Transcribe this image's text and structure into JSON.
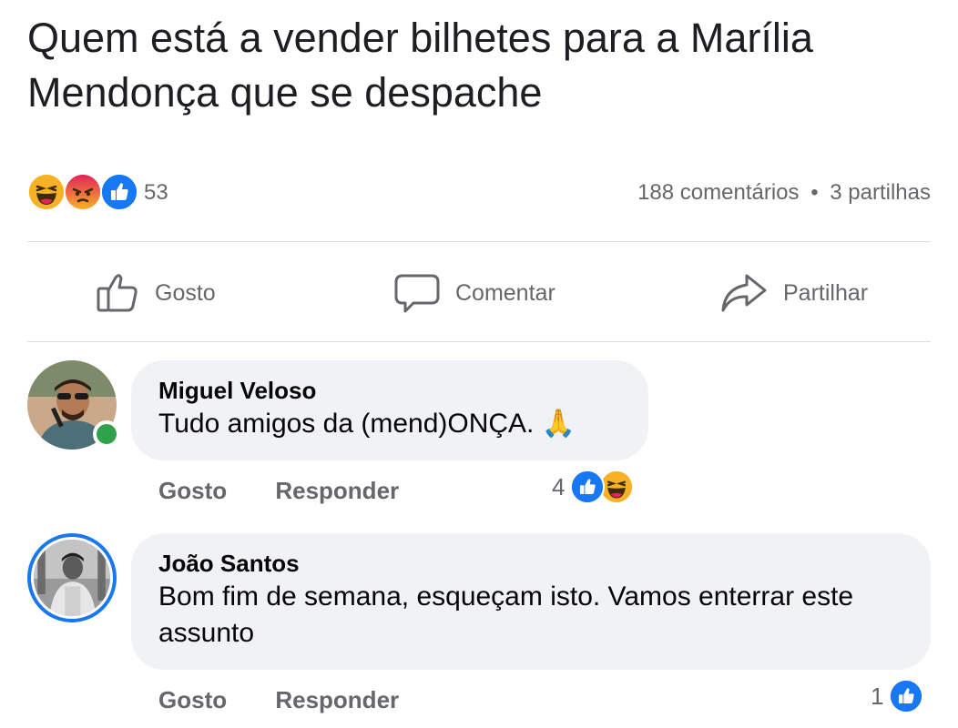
{
  "post": {
    "text": "Quem está a vender bilhetes para a Marília Mendonça que se despache"
  },
  "stats": {
    "reaction_count": "53",
    "comments": "188 comentários",
    "separator": "•",
    "shares": "3 partilhas",
    "reactions": [
      "haha-icon",
      "angry-icon",
      "like-icon"
    ]
  },
  "actions": {
    "like": "Gosto",
    "comment": "Comentar",
    "share": "Partilhar"
  },
  "comments": [
    {
      "name": "Miguel Veloso",
      "text": "Tudo amigos da (mend)ONÇA. 🙏",
      "like_label": "Gosto",
      "reply_label": "Responder",
      "reaction_count": "4",
      "online": true
    },
    {
      "name": "João Santos",
      "text": "Bom fim de semana, esqueçam isto. Vamos enterrar este assunto",
      "like_label": "Gosto",
      "reply_label": "Responder",
      "reaction_count": "1",
      "online": false
    }
  ],
  "colors": {
    "like_blue": "#1877f2",
    "angry_orange": "#f26b1d",
    "haha_yellow": "#f7b125",
    "online_green": "#31a24c",
    "bubble_gray": "#f0f2f5",
    "meta_gray": "#65676b"
  }
}
